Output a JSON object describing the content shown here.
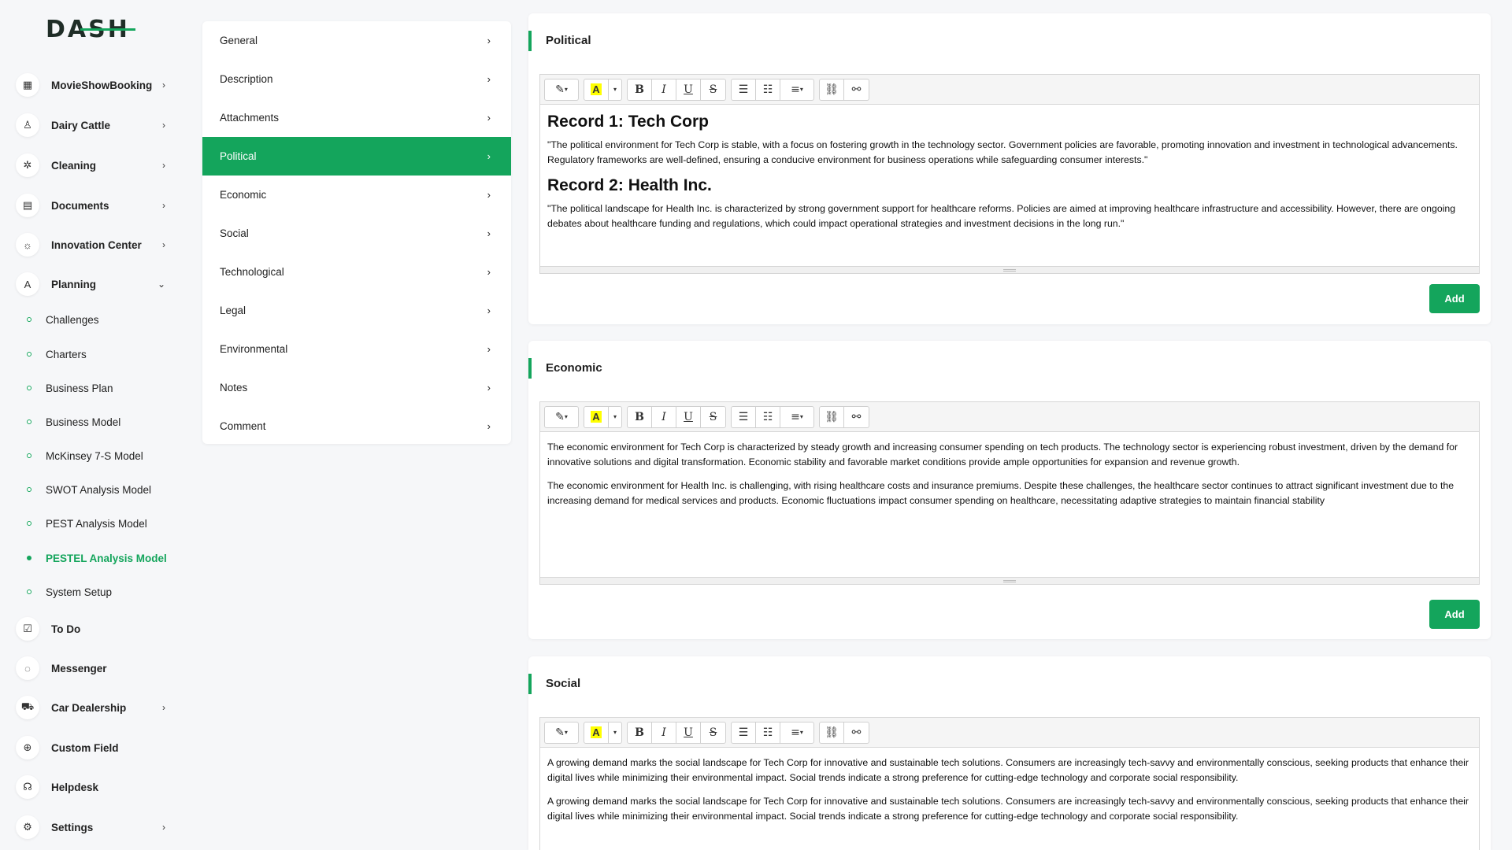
{
  "brand": {
    "logo_text": "DASH",
    "accent": "#14a55c"
  },
  "sidebar": {
    "items": [
      {
        "label": "MovieShowBooking",
        "icon": "film-icon",
        "glyph": "▦",
        "chevron": "›"
      },
      {
        "label": "Dairy Cattle",
        "icon": "bottle-icon",
        "glyph": "♙",
        "chevron": "›"
      },
      {
        "label": "Cleaning",
        "icon": "sparkle-icon",
        "glyph": "✲",
        "chevron": "›"
      },
      {
        "label": "Documents",
        "icon": "document-icon",
        "glyph": "▤",
        "chevron": "›"
      },
      {
        "label": "Innovation Center",
        "icon": "lightbulb-icon",
        "glyph": "☼",
        "chevron": "›"
      },
      {
        "label": "Planning",
        "icon": "planning-icon",
        "glyph": "A",
        "chevron": "⌄"
      }
    ],
    "planning_sub": [
      "Challenges",
      "Charters",
      "Business Plan",
      "Business Model",
      "McKinsey 7-S Model",
      "SWOT Analysis Model",
      "PEST Analysis Model",
      "PESTEL Analysis Model",
      "System Setup"
    ],
    "bottom_items": [
      {
        "label": "To Do",
        "icon": "checklist-icon",
        "glyph": "☑",
        "chevron": ""
      },
      {
        "label": "Messenger",
        "icon": "chat-icon",
        "glyph": "◌",
        "chevron": ""
      },
      {
        "label": "Car Dealership",
        "icon": "car-icon",
        "glyph": "⛟",
        "chevron": "›"
      },
      {
        "label": "Custom Field",
        "icon": "plus-circle-icon",
        "glyph": "⊕",
        "chevron": ""
      },
      {
        "label": "Helpdesk",
        "icon": "headset-icon",
        "glyph": "☊",
        "chevron": ""
      },
      {
        "label": "Settings",
        "icon": "gear-icon",
        "glyph": "⚙",
        "chevron": "›"
      }
    ]
  },
  "menu": {
    "items": [
      "General",
      "Description",
      "Attachments",
      "Political",
      "Economic",
      "Social",
      "Technological",
      "Legal",
      "Environmental",
      "Notes",
      "Comment"
    ],
    "active": "Political",
    "chevron": "›"
  },
  "toolbar": {
    "magic": "✎",
    "caret": "▾",
    "highlight": "A",
    "bold": "B",
    "italic": "I",
    "underline": "U",
    "strike": "S",
    "ul": "☰",
    "ol": "☷",
    "align": "≡",
    "link": "⛓",
    "unlink": "⚯"
  },
  "cards": {
    "political": {
      "title": "Political",
      "h1": "Record 1: Tech Corp",
      "p1": "\"The political environment for Tech Corp is stable, with a focus on fostering growth in the technology sector. Government policies are favorable, promoting innovation and investment in technological advancements. Regulatory frameworks are well-defined, ensuring a conducive environment for business operations while safeguarding consumer interests.\"",
      "h2": "Record 2: Health Inc.",
      "p2": "\"The political landscape for Health Inc. is characterized by strong government support for healthcare reforms. Policies are aimed at improving healthcare infrastructure and accessibility. However, there are ongoing debates about healthcare funding and regulations, which could impact operational strategies and investment decisions in the long run.\"",
      "button": "Add"
    },
    "economic": {
      "title": "Economic",
      "p1": "The economic environment for Tech Corp is characterized by steady growth and increasing consumer spending on tech products. The technology sector is experiencing robust investment, driven by the demand for innovative solutions and digital transformation. Economic stability and favorable market conditions provide ample opportunities for expansion and revenue growth.",
      "p2": "The economic environment for Health Inc. is challenging, with rising healthcare costs and insurance premiums. Despite these challenges, the healthcare sector continues to attract significant investment due to the increasing demand for medical services and products. Economic fluctuations impact consumer spending on healthcare, necessitating adaptive strategies to maintain financial stability",
      "button": "Add"
    },
    "social": {
      "title": "Social",
      "p1": "A growing demand marks the social landscape for Tech Corp for innovative and sustainable tech solutions. Consumers are increasingly tech-savvy and environmentally conscious, seeking products that enhance their digital lives while minimizing their environmental impact. Social trends indicate a strong preference for cutting-edge technology and corporate social responsibility.",
      "p2": "A growing demand marks the social landscape for Tech Corp for innovative and sustainable tech solutions. Consumers are increasingly tech-savvy and environmentally conscious, seeking products that enhance their digital lives while minimizing their environmental impact. Social trends indicate a strong preference for cutting-edge technology and corporate social responsibility."
    }
  }
}
